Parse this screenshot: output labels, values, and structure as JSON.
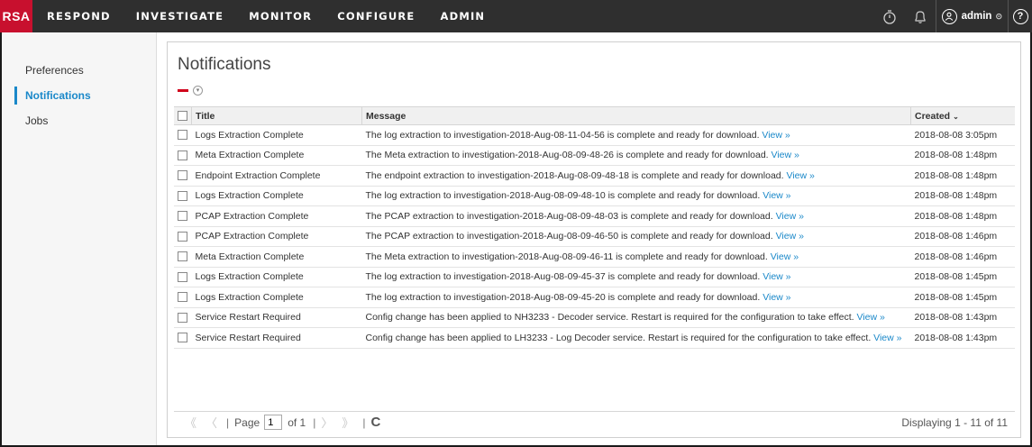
{
  "app": {
    "logo": "RSA",
    "nav": [
      "RESPOND",
      "INVESTIGATE",
      "MONITOR",
      "CONFIGURE",
      "ADMIN"
    ],
    "user": "admin"
  },
  "sidebar": {
    "items": [
      {
        "label": "Preferences",
        "active": false
      },
      {
        "label": "Notifications",
        "active": true
      },
      {
        "label": "Jobs",
        "active": false
      }
    ]
  },
  "main": {
    "title": "Notifications",
    "columns": {
      "title": "Title",
      "message": "Message",
      "created": "Created"
    },
    "view_link": "View »",
    "rows": [
      {
        "title": "Logs Extraction Complete",
        "message": "The log extraction to investigation-2018-Aug-08-11-04-56 is complete and ready for download.",
        "created": "2018-08-08 3:05pm"
      },
      {
        "title": "Meta Extraction Complete",
        "message": "The Meta extraction to investigation-2018-Aug-08-09-48-26 is complete and ready for download.",
        "created": "2018-08-08 1:48pm"
      },
      {
        "title": "Endpoint Extraction Complete",
        "message": "The endpoint extraction to investigation-2018-Aug-08-09-48-18 is complete and ready for download.",
        "created": "2018-08-08 1:48pm"
      },
      {
        "title": "Logs Extraction Complete",
        "message": "The log extraction to investigation-2018-Aug-08-09-48-10 is complete and ready for download.",
        "created": "2018-08-08 1:48pm"
      },
      {
        "title": "PCAP Extraction Complete",
        "message": "The PCAP extraction to investigation-2018-Aug-08-09-48-03 is complete and ready for download.",
        "created": "2018-08-08 1:48pm"
      },
      {
        "title": "PCAP Extraction Complete",
        "message": "The PCAP extraction to investigation-2018-Aug-08-09-46-50 is complete and ready for download.",
        "created": "2018-08-08 1:46pm"
      },
      {
        "title": "Meta Extraction Complete",
        "message": "The Meta extraction to investigation-2018-Aug-08-09-46-11 is complete and ready for download.",
        "created": "2018-08-08 1:46pm"
      },
      {
        "title": "Logs Extraction Complete",
        "message": "The log extraction to investigation-2018-Aug-08-09-45-37 is complete and ready for download.",
        "created": "2018-08-08 1:45pm"
      },
      {
        "title": "Logs Extraction Complete",
        "message": "The log extraction to investigation-2018-Aug-08-09-45-20 is complete and ready for download.",
        "created": "2018-08-08 1:45pm"
      },
      {
        "title": "Service Restart Required",
        "message": "Config change has been applied to NH3233 - Decoder service. Restart is required for the configuration to take effect.",
        "created": "2018-08-08 1:43pm"
      },
      {
        "title": "Service Restart Required",
        "message": "Config change has been applied to LH3233 - Log Decoder service. Restart is required for the configuration to take effect.",
        "created": "2018-08-08 1:43pm"
      }
    ]
  },
  "pager": {
    "page_label": "Page",
    "page_value": "1",
    "of_label": "of 1",
    "displaying": "Displaying 1 - 11 of 11"
  },
  "colors": {
    "topbar": "#2f2f2f",
    "logo": "#c8102e",
    "accent": "#1a88c9",
    "remove": "#d0021b"
  },
  "icons": [
    "stopwatch-icon",
    "bell-icon",
    "user-icon",
    "help-icon",
    "remove-icon",
    "refresh-icon"
  ]
}
